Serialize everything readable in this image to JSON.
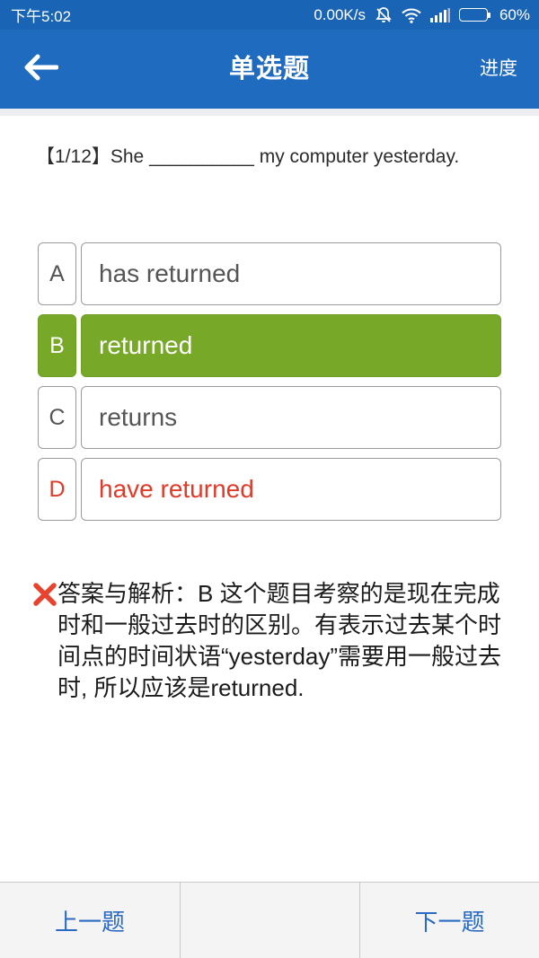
{
  "status_bar": {
    "time": "下午5:02",
    "network_speed": "0.00K/s",
    "battery": "60%",
    "battery_level": 0.6,
    "icons": [
      "mute-icon",
      "wifi-icon",
      "signal-icon",
      "battery-icon"
    ]
  },
  "header": {
    "title": "单选题",
    "progress_label": "进度",
    "back_icon": "back-arrow-icon",
    "color": "#1f6bc0"
  },
  "question": {
    "text": "【1/12】She __________ my computer yesterday."
  },
  "options": [
    {
      "letter": "A",
      "text": "has returned",
      "state": "normal"
    },
    {
      "letter": "B",
      "text": "returned",
      "state": "selected"
    },
    {
      "letter": "C",
      "text": "returns",
      "state": "normal"
    },
    {
      "letter": "D",
      "text": "have returned",
      "state": "wrong"
    }
  ],
  "colors": {
    "selected": "#77a827",
    "wrong": "#e03b2a",
    "nav_text": "#2a6ac3"
  },
  "explanation": {
    "icon": "wrong-x-icon",
    "text": "答案与解析：B 这个题目考察的是现在完成时和一般过去时的区别。有表示过去某个时间点的时间状语“yesterday”需要用一般过去时, 所以应该是returned."
  },
  "bottom_nav": {
    "prev_label": "上一题",
    "middle_label": "",
    "next_label": "下一题"
  }
}
